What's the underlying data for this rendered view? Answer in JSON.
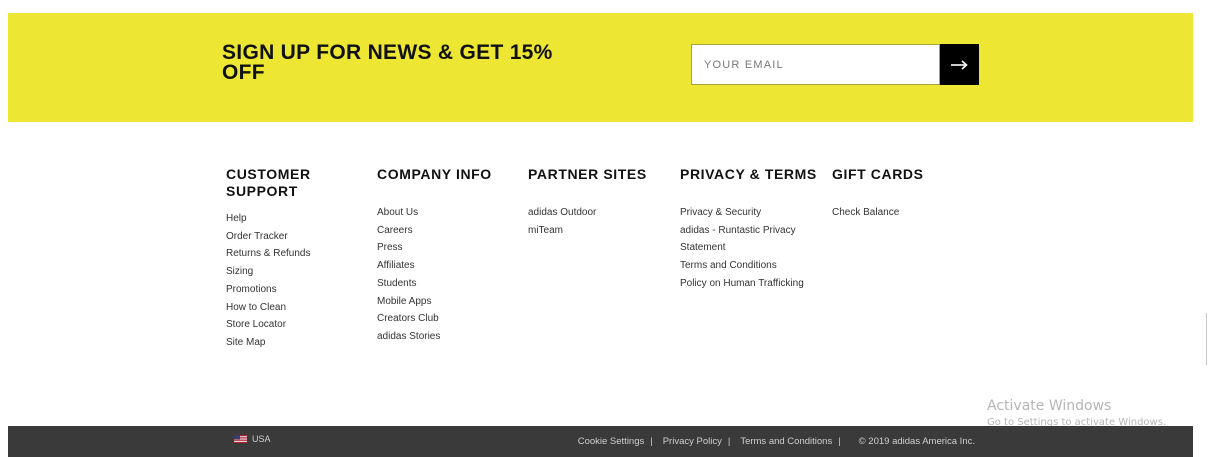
{
  "signup": {
    "title": "SIGN UP FOR NEWS & GET 15% OFF",
    "email_placeholder": "YOUR EMAIL",
    "submit_icon": "arrow-right-icon"
  },
  "footer_columns": [
    {
      "title": "CUSTOMER SUPPORT",
      "links": [
        "Help",
        "Order Tracker",
        "Returns & Refunds",
        "Sizing",
        "Promotions",
        "How to Clean",
        "Store Locator",
        "Site Map"
      ]
    },
    {
      "title": "COMPANY INFO",
      "links": [
        "About Us",
        "Careers",
        "Press",
        "Affiliates",
        "Students",
        "Mobile Apps",
        "Creators Club",
        "adidas Stories"
      ]
    },
    {
      "title": "PARTNER SITES",
      "links": [
        "adidas Outdoor",
        "miTeam"
      ]
    },
    {
      "title": "PRIVACY & TERMS",
      "links": [
        "Privacy & Security",
        "adidas - Runtastic Privacy",
        "Statement",
        "Terms and Conditions",
        "Policy on Human Trafficking"
      ]
    },
    {
      "title": "GIFT CARDS",
      "links": [
        "Check Balance"
      ]
    }
  ],
  "watermark": {
    "title": "Activate Windows",
    "subtitle": "Go to Settings to activate Windows."
  },
  "bottom_bar": {
    "locale_icon": "us-flag-icon",
    "locale_label": "USA",
    "links": [
      "Cookie Settings",
      "Privacy Policy",
      "Terms and Conditions"
    ],
    "separator": "|",
    "copyright": "© 2019 adidas America Inc."
  },
  "colors": {
    "signup_background": "#ede734",
    "bottom_bar_background": "#3a3a3a",
    "submit_button": "#000000"
  }
}
